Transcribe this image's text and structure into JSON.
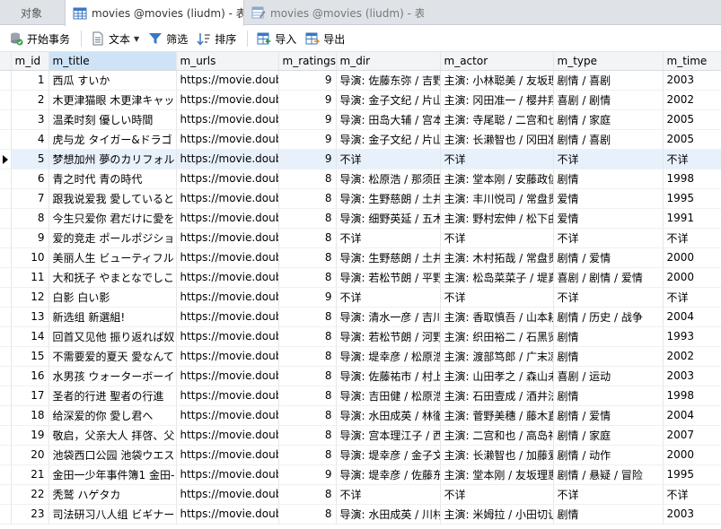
{
  "tabs": {
    "objects": "对象",
    "active": "movies @movies (liudm) - 表",
    "inactive": "movies @movies (liudm) - 表"
  },
  "toolbar": {
    "begin_transaction": "开始事务",
    "text": "文本",
    "filter": "筛选",
    "sort": "排序",
    "import": "导入",
    "export": "导出"
  },
  "columns": [
    "m_id",
    "m_title",
    "m_urls",
    "m_ratings",
    "m_dir",
    "m_actor",
    "m_type",
    "m_time"
  ],
  "rows": [
    [
      "1",
      "西瓜 すいか",
      "https://movie.doub",
      "9",
      "导演: 佐藤东弥 / 吉野",
      "主演: 小林聪美 / 友坂理",
      "剧情 / 喜剧",
      "2003"
    ],
    [
      "2",
      "木更津猫眼 木更津キャッ",
      "https://movie.doub",
      "9",
      "导演: 金子文纪 / 片山",
      "主演: 冈田准一 / 樱井翔",
      "喜剧 / 剧情",
      "2002"
    ],
    [
      "3",
      "温柔时刻 優しい時間",
      "https://movie.doub",
      "9",
      "导演: 田岛大辅 / 宫本",
      "主演: 寺尾聪 / 二宫和也",
      "剧情 / 家庭",
      "2005"
    ],
    [
      "4",
      "虎与龙 タイガー&ドラゴ",
      "https://movie.doub",
      "9",
      "导演: 金子文纪 / 片山",
      "主演: 长濑智也 / 冈田准",
      "剧情 / 喜剧",
      "2005"
    ],
    [
      "5",
      "梦想加州 夢のカリフォル",
      "https://movie.doub",
      "9",
      "不详",
      "不详",
      "不详",
      "不详"
    ],
    [
      "6",
      "青之时代 青の時代",
      "https://movie.doub",
      "8",
      "导演: 松原浩 / 那须田",
      "主演: 堂本刚 / 安藤政信",
      "剧情",
      "1998"
    ],
    [
      "7",
      "跟我说爱我 愛していると",
      "https://movie.doub",
      "8",
      "导演: 生野慈朗 / 土井",
      "主演: 丰川悦司 / 常盘贵",
      "爱情",
      "1995"
    ],
    [
      "8",
      "今生只爱你 君だけに愛を",
      "https://movie.doub",
      "8",
      "导演: 细野英延 / 五木",
      "主演: 野村宏伸 / 松下由",
      "爱情",
      "1991"
    ],
    [
      "9",
      "爱的竞走 ポールポジショ",
      "https://movie.doub",
      "8",
      "不详",
      "不详",
      "不详",
      "不详"
    ],
    [
      "10",
      "美丽人生 ビューティフル",
      "https://movie.doub",
      "8",
      "导演: 生野慈朗 / 土井",
      "主演: 木村拓哉 / 常盘贵",
      "剧情 / 爱情",
      "2000"
    ],
    [
      "11",
      "大和抚子 やまとなでしこ",
      "https://movie.doub",
      "8",
      "导演: 若松节朗 / 平野",
      "主演: 松岛菜菜子 / 堤真",
      "喜剧 / 剧情 / 爱情",
      "2000"
    ],
    [
      "12",
      "白影 白い影",
      "https://movie.doub",
      "9",
      "不详",
      "不详",
      "不详",
      "不详"
    ],
    [
      "13",
      "新选组 新選組!",
      "https://movie.doub",
      "8",
      "导演: 清水一彦 / 吉川",
      "主演: 香取慎吾 / 山本耕",
      "剧情 / 历史 / 战争",
      "2004"
    ],
    [
      "14",
      "回首又见他 振り返れば奴",
      "https://movie.doub",
      "8",
      "导演: 若松节朗 / 河野",
      "主演: 织田裕二 / 石黑贤",
      "剧情",
      "1993"
    ],
    [
      "15",
      "不需要爱的夏天 愛なんて",
      "https://movie.doub",
      "8",
      "导演: 堤幸彦 / 松原浩",
      "主演: 渡部笃郎 / 广末凉",
      "剧情",
      "2002"
    ],
    [
      "16",
      "水男孩 ウォーターボーイ",
      "https://movie.doub",
      "8",
      "导演: 佐藤祐市 / 村上",
      "主演: 山田孝之 / 森山未",
      "喜剧 / 运动",
      "2003"
    ],
    [
      "17",
      "圣者的行进 聖者の行進",
      "https://movie.doub",
      "8",
      "导演: 吉田健 / 松原浩",
      "主演: 石田壹成 / 酒井法",
      "剧情",
      "1998"
    ],
    [
      "18",
      "给深爱的你 愛し君へ",
      "https://movie.doub",
      "8",
      "导演: 水田成英 / 林徹",
      "主演: 菅野美穗 / 藤木直",
      "剧情 / 爱情",
      "2004"
    ],
    [
      "19",
      "敬启，父亲大人 拝啓、父",
      "https://movie.doub",
      "8",
      "导演: 宫本理江子 / 西",
      "主演: 二宫和也 / 高岛礼",
      "剧情 / 家庭",
      "2007"
    ],
    [
      "20",
      "池袋西口公园 池袋ウエス",
      "https://movie.doub",
      "8",
      "导演: 堤幸彦 / 金子文",
      "主演: 长濑智也 / 加藤爱",
      "剧情 / 动作",
      "2000"
    ],
    [
      "21",
      "金田一少年事件簿1 金田-",
      "https://movie.doub",
      "9",
      "导演: 堤幸彦 / 佐藤东",
      "主演: 堂本刚 / 友坂理惠",
      "剧情 / 悬疑 / 冒险",
      "1995"
    ],
    [
      "22",
      "秃鹫 ハゲタカ",
      "https://movie.doub",
      "8",
      "不详",
      "不详",
      "不详",
      "不详"
    ],
    [
      "23",
      "司法研习八人组 ビギナー",
      "https://movie.doub",
      "8",
      "导演: 水田成英 / 川村",
      "主演: 米姆拉 / 小田切让",
      "剧情",
      "2003"
    ]
  ],
  "current_row_index": 4,
  "colors": {
    "selected_header": "#cfe3f7",
    "current_row": "#e8f1fb",
    "tabbar": "#dfe3e8"
  }
}
